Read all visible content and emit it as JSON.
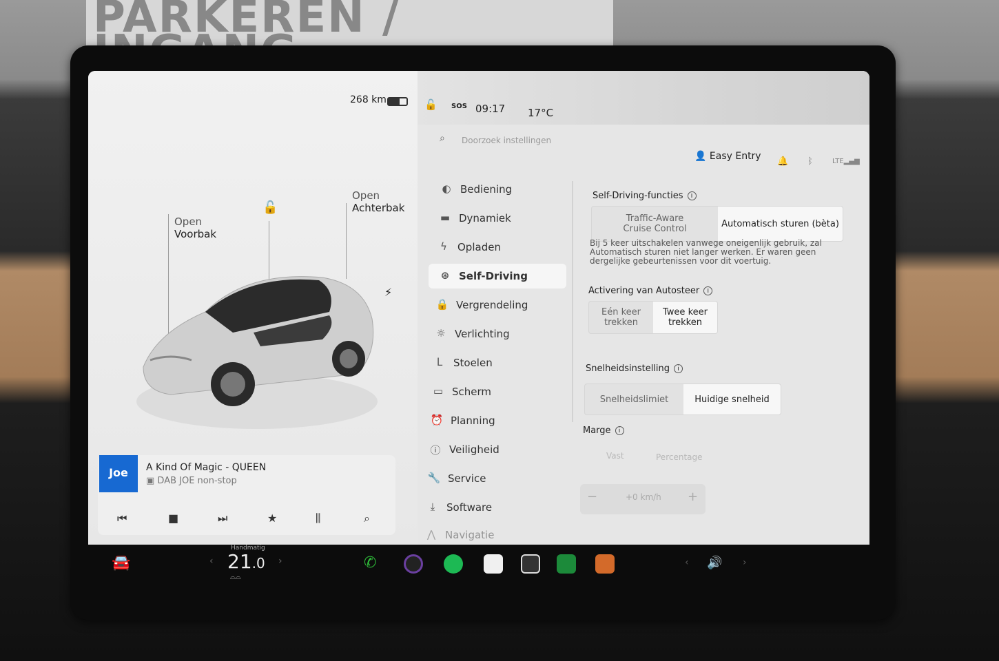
{
  "background_sign": "PARKEREN / INGANG",
  "status": {
    "range": "268 km",
    "sos": "SOS",
    "time": "09:17",
    "temperature": "17°C"
  },
  "search": {
    "placeholder": "Doorzoek instellingen"
  },
  "profile": {
    "name": "Easy Entry"
  },
  "car": {
    "frunk_line1": "Open",
    "frunk_line2": "Voorbak",
    "trunk_line1": "Open",
    "trunk_line2": "Achterbak"
  },
  "menu": [
    {
      "label": "Bediening",
      "icon": "toggle-icon"
    },
    {
      "label": "Dynamiek",
      "icon": "car-icon"
    },
    {
      "label": "Opladen",
      "icon": "bolt-icon"
    },
    {
      "label": "Self-Driving",
      "icon": "steering-wheel-icon"
    },
    {
      "label": "Vergrendeling",
      "icon": "lock-icon"
    },
    {
      "label": "Verlichting",
      "icon": "sun-icon"
    },
    {
      "label": "Stoelen",
      "icon": "seat-icon"
    },
    {
      "label": "Scherm",
      "icon": "display-icon"
    },
    {
      "label": "Planning",
      "icon": "alarm-clock-icon"
    },
    {
      "label": "Veiligheid",
      "icon": "info-icon"
    },
    {
      "label": "Service",
      "icon": "wrench-icon"
    },
    {
      "label": "Software",
      "icon": "download-icon"
    },
    {
      "label": "Navigatie",
      "icon": "navigation-icon"
    }
  ],
  "settings": {
    "self_driving_title": "Self-Driving-functies",
    "sd_option1_line1": "Traffic-Aware",
    "sd_option1_line2": "Cruise Control",
    "sd_option2": "Automatisch sturen (bèta)",
    "warning": "Bij 5 keer uitschakelen vanwege oneigenlijk gebruik, zal Automatisch sturen niet langer werken. Er waren geen dergelijke gebeurtenissen voor dit voertuig.",
    "activation_title": "Activering van Autosteer",
    "act_option1_line1": "Eén keer",
    "act_option1_line2": "trekken",
    "act_option2_line1": "Twee keer",
    "act_option2_line2": "trekken",
    "speed_title": "Snelheidsinstelling",
    "speed_option1": "Snelheidslimiet",
    "speed_option2": "Huidige snelheid",
    "margin_title": "Marge",
    "margin_option1": "Vast",
    "margin_option2": "Percentage",
    "margin_minus": "−",
    "margin_value": "+0 km/h",
    "margin_plus": "+"
  },
  "music": {
    "station_logo": "Joe",
    "track": "A Kind Of Magic - QUEEN",
    "source": "DAB JOE non-stop"
  },
  "taskbar": {
    "climate_mode": "Handmatig",
    "temp_whole": "21",
    "temp_decimal": ".0"
  },
  "colors": {
    "screen_bg": "#ececec",
    "active_item": "#f6f6f6",
    "phone_green": "#2fbf3a",
    "spotify_green": "#1db954",
    "joe_blue": "#1769d2"
  }
}
